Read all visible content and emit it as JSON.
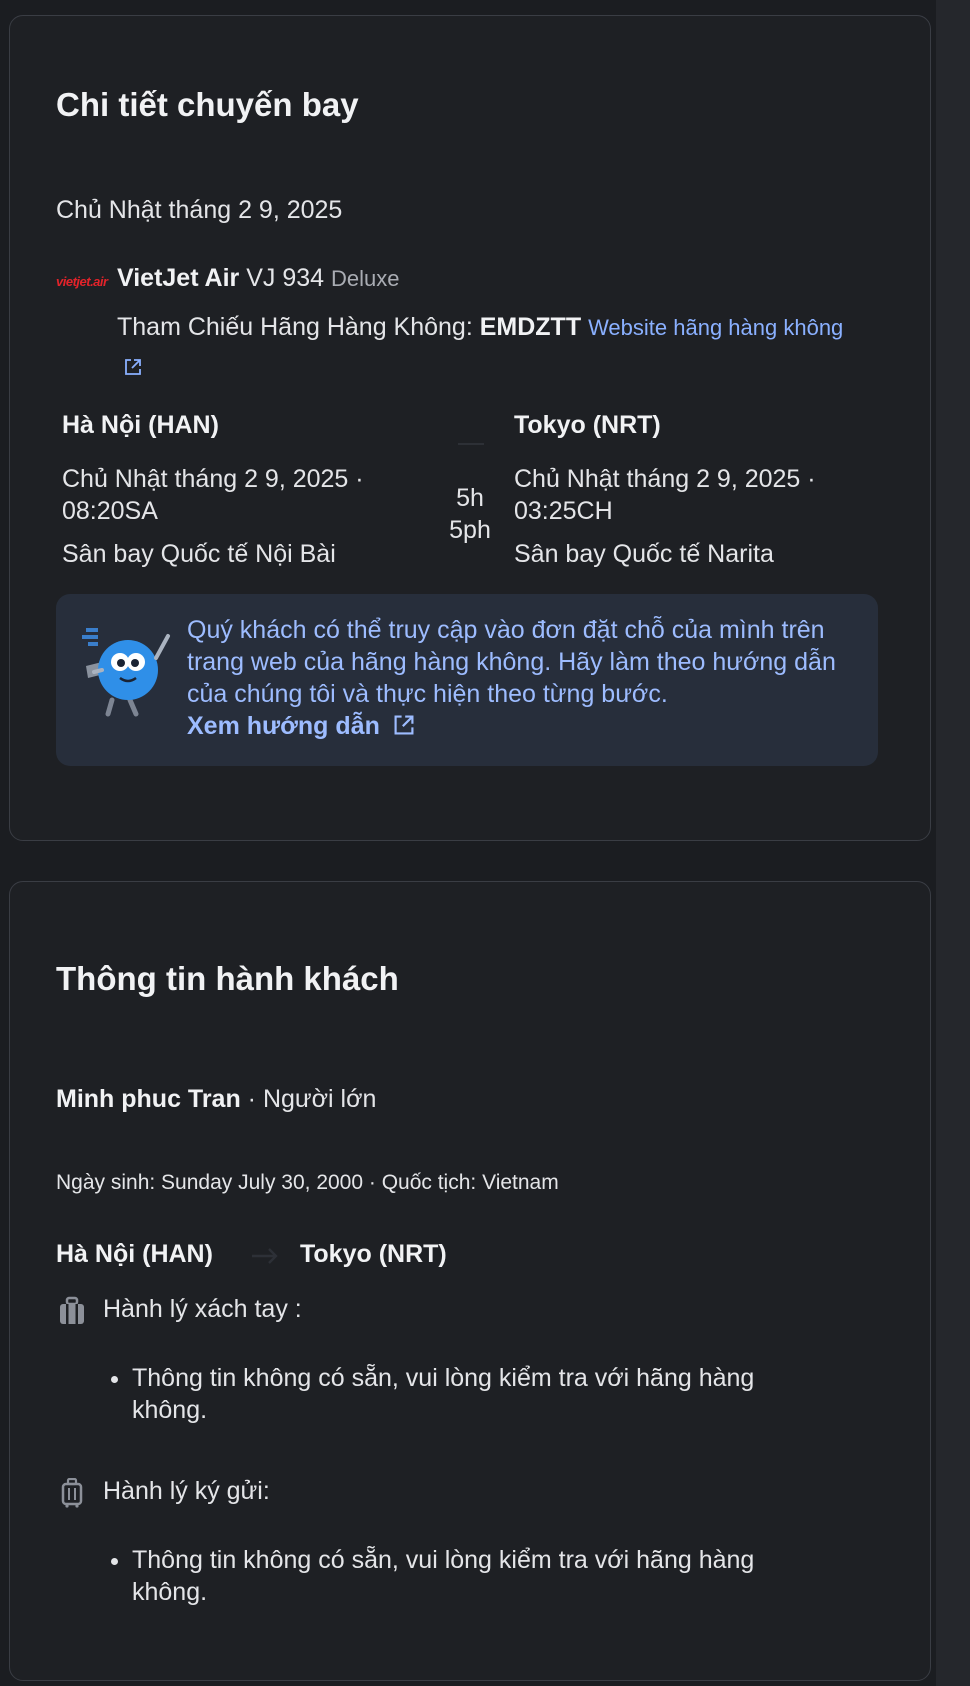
{
  "flight_card": {
    "title": "Chi tiết chuyến bay",
    "date": "Chủ Nhật tháng 2 9, 2025",
    "airline": {
      "logo_text": "vietjet.air",
      "name": "VietJet Air",
      "flight_number": "VJ 934",
      "fare_class": "Deluxe"
    },
    "reference": {
      "label": "Tham Chiếu Hãng Hàng Không:",
      "code": "EMDZTT",
      "website_link": "Website hãng hàng không"
    },
    "departure": {
      "city": "Hà Nội (HAN)",
      "datetime": "Chủ Nhật tháng 2 9, 2025 · 08:20SA",
      "airport": "Sân bay Quốc tế Nội Bài"
    },
    "duration": "5h 5ph",
    "arrival": {
      "city": "Tokyo (NRT)",
      "datetime": "Chủ Nhật tháng 2 9, 2025 · 03:25CH",
      "airport": "Sân bay Quốc tế Narita"
    },
    "info_box": {
      "message": "Quý khách có thể truy cập vào đơn đặt chỗ của mình trên trang web của hãng hàng không. Hãy làm theo hướng dẫn của chúng tôi và thực hiện theo từng bước.",
      "link": "Xem hướng dẫn"
    }
  },
  "passenger_card": {
    "title": "Thông tin hành khách",
    "name": "Minh phuc Tran",
    "type": "· Người lớn",
    "details": "Ngày sinh: Sunday July 30, 2000 · Quốc tịch: Vietnam",
    "route": {
      "from": "Hà Nội (HAN)",
      "to": "Tokyo (NRT)"
    },
    "baggage": [
      {
        "icon": "carry-on-bag-icon",
        "label": "Hành lý xách tay :",
        "note": "Thông tin không có sẵn, vui lòng kiểm tra với hãng hàng không."
      },
      {
        "icon": "checked-luggage-icon",
        "label": "Hành lý ký gửi:",
        "note": "Thông tin không có sẵn, vui lòng kiểm tra với hãng hàng không."
      }
    ]
  },
  "colors": {
    "background": "#1b1d21",
    "card": "#1e2024",
    "card_border": "#3a3d44",
    "info_box": "#272e3b",
    "link": "#8ab0ff",
    "airline_brand": "#e2232a"
  }
}
